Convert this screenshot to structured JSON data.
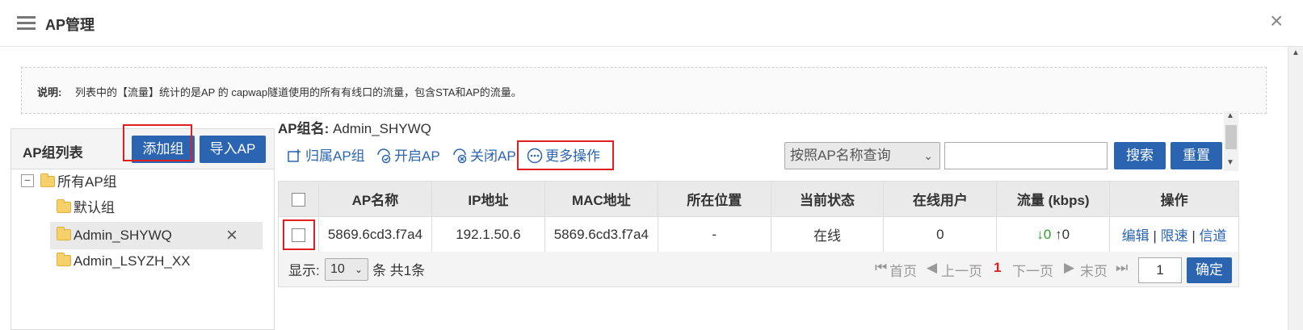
{
  "header": {
    "title": "AP管理",
    "close": "×"
  },
  "notice": {
    "label": "说明:",
    "text": "列表中的【流量】统计的是AP 的 capwap隧道使用的所有有线口的流量，包含STA和AP的流量。"
  },
  "left": {
    "title": "AP组列表",
    "add_group": "添加组",
    "import_ap": "导入AP",
    "tree": {
      "root": "所有AP组",
      "expander": "−",
      "children": [
        "默认组",
        "Admin_SHYWQ",
        "Admin_LSYZH_XX"
      ],
      "delete": "×"
    }
  },
  "right": {
    "group_label": "AP组名:",
    "group_name": "Admin_SHYWQ",
    "toolbar": {
      "assign": "归属AP组",
      "enable": "开启AP",
      "disable": "关闭AP",
      "more": "更多操作"
    },
    "search": {
      "select_value": "按照AP名称查询",
      "input_value": "",
      "search_label": "搜索",
      "reset_label": "重置"
    },
    "table": {
      "headers": [
        "AP名称",
        "IP地址",
        "MAC地址",
        "所在位置",
        "当前状态",
        "在线用户",
        "流量 (kbps)",
        "操作"
      ],
      "rows": [
        {
          "name": "5869.6cd3.f7a4",
          "ip": "192.1.50.6",
          "mac": "5869.6cd3.f7a4",
          "location": "-",
          "status": "在线",
          "users": "0",
          "down": "↓0",
          "up": "↑0",
          "edit": "编辑",
          "sep": "|",
          "limit": "限速",
          "channel": "信道"
        }
      ]
    },
    "pager": {
      "show_label": "显示:",
      "page_size": "10",
      "total": "条 共1条",
      "first": "首页",
      "prev": "上一页",
      "current": "1",
      "next": "下一页",
      "last": "末页",
      "page_input": "1",
      "confirm": "确定"
    }
  },
  "colors": {
    "accent": "#2b64b1",
    "highlight_border": "#e02020",
    "download": "#2aa12a"
  }
}
